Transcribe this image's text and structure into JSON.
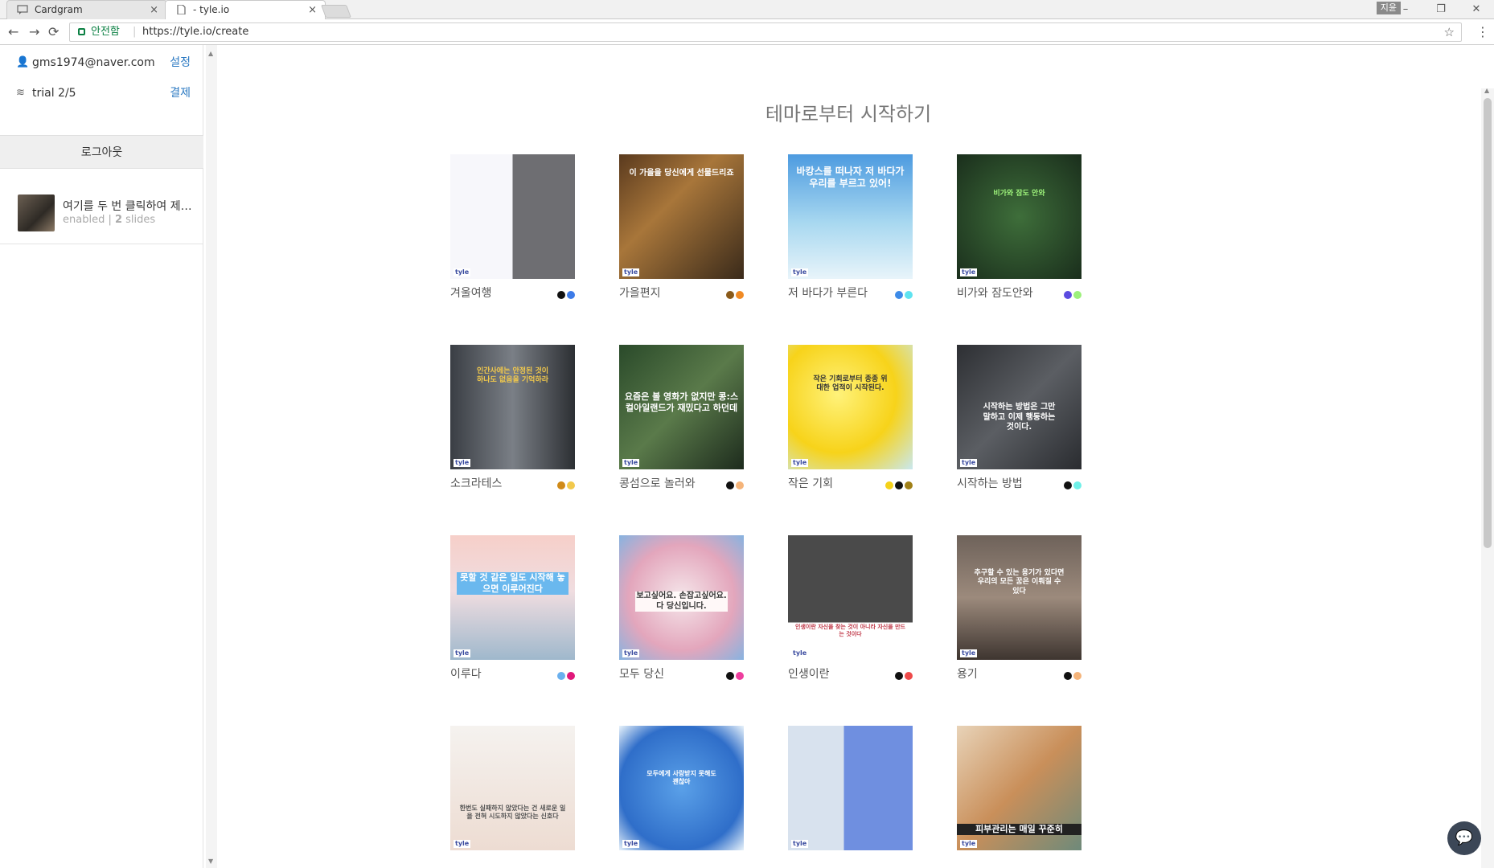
{
  "browser": {
    "tabs": [
      {
        "title": "Cardgram",
        "close": "×"
      },
      {
        "title": "- tyle.io",
        "close": "×"
      }
    ],
    "window_label": "지윤",
    "window_controls": [
      "–",
      "❐",
      "✕"
    ],
    "security_label": "안전함",
    "url": "https://tyle.io/create"
  },
  "sidebar": {
    "email": "gms1974@naver.com",
    "settings_label": "설정",
    "plan": "trial 2/5",
    "pay_label": "결제",
    "logout_label": "로그아웃",
    "project": {
      "title": "여기를 두 번 클릭하여 제…",
      "meta_prefix": "enabled | ",
      "meta_count": "2",
      "meta_suffix": " slides"
    }
  },
  "main": {
    "heading": "테마로부터 시작하기"
  },
  "themes": [
    {
      "name": "겨울여행",
      "colors": [
        "#111111",
        "#3d7be8"
      ],
      "thumb_text": ""
    },
    {
      "name": "가을편지",
      "colors": [
        "#8a5a1a",
        "#f08a24"
      ],
      "thumb_text": "이 가을을 당신에게 선물드리죠"
    },
    {
      "name": "저 바다가 부른다",
      "colors": [
        "#3d8be8",
        "#5fe3f0"
      ],
      "thumb_text": "바캉스를 떠나자 저 바다가 우리를 부르고 있어!"
    },
    {
      "name": "비가와 잠도안와",
      "colors": [
        "#5b4be0",
        "#9cf07a"
      ],
      "thumb_text": "비가와 잠도 안와"
    },
    {
      "name": "소크라테스",
      "colors": [
        "#d08a18",
        "#f2c94c"
      ],
      "thumb_text": "인간사에는 안정된 것이 하나도 없음을 기억하라"
    },
    {
      "name": "콩섬으로 놀러와",
      "colors": [
        "#111111",
        "#f5b47a"
      ],
      "thumb_text": "요즘은 볼 영화가 없지만 콩:스컬아일랜드가 재밌다고 하던데"
    },
    {
      "name": "작은 기회",
      "colors": [
        "#f5d21a",
        "#111111",
        "#a08017"
      ],
      "thumb_text": "작은 기회로부터 종종 위대한 업적이 시작된다."
    },
    {
      "name": "시작하는 방법",
      "colors": [
        "#111111",
        "#6ff0e8"
      ],
      "thumb_text": "시작하는 방법은 그만 말하고 이제 행동하는 것이다."
    },
    {
      "name": "이루다",
      "colors": [
        "#6ab0ee",
        "#e0187a"
      ],
      "thumb_text": "못할 것 같은 일도 시작해 놓으면 이루어진다"
    },
    {
      "name": "모두 당신",
      "colors": [
        "#111111",
        "#ee3e9e"
      ],
      "thumb_text": "보고싶어요. 손잡고싶어요. 다 당신입니다."
    },
    {
      "name": "인생이란",
      "colors": [
        "#111111",
        "#ee4a4a"
      ],
      "thumb_text": "인생이란 자신을 찾는 것이 아니라 자신을 만드는 것이다"
    },
    {
      "name": "용기",
      "colors": [
        "#111111",
        "#f5b47a"
      ],
      "thumb_text": "추구할 수 있는 용기가 있다면 우리의 모든 꿈은 이뤄질 수 있다"
    },
    {
      "name": "",
      "colors": [],
      "thumb_text": "한번도 실패하지 않았다는 건 새로운 일을 전혀 시도하지 않았다는 신호다"
    },
    {
      "name": "",
      "colors": [],
      "thumb_text": "모두에게 사랑받지 못해도 괜찮아"
    },
    {
      "name": "",
      "colors": [],
      "thumb_text": ""
    },
    {
      "name": "",
      "colors": [],
      "thumb_text": "피부관리는 매일 꾸준히"
    }
  ],
  "logo_text": "tyle",
  "chat_icon": "speech-bubble"
}
